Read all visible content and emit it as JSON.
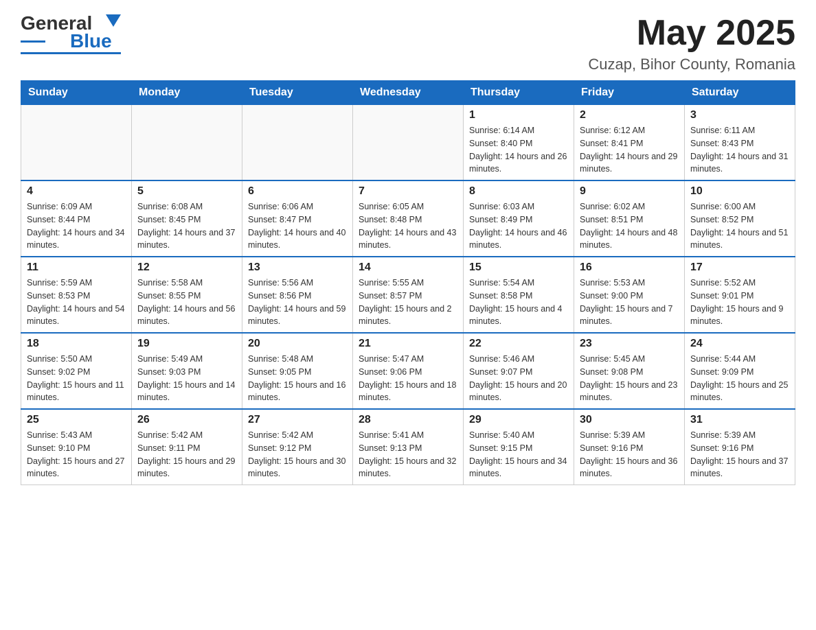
{
  "header": {
    "logo_general": "General",
    "logo_blue": "Blue",
    "month_title": "May 2025",
    "location": "Cuzap, Bihor County, Romania"
  },
  "days_of_week": [
    "Sunday",
    "Monday",
    "Tuesday",
    "Wednesday",
    "Thursday",
    "Friday",
    "Saturday"
  ],
  "weeks": [
    [
      {
        "day": "",
        "info": ""
      },
      {
        "day": "",
        "info": ""
      },
      {
        "day": "",
        "info": ""
      },
      {
        "day": "",
        "info": ""
      },
      {
        "day": "1",
        "info": "Sunrise: 6:14 AM\nSunset: 8:40 PM\nDaylight: 14 hours and 26 minutes."
      },
      {
        "day": "2",
        "info": "Sunrise: 6:12 AM\nSunset: 8:41 PM\nDaylight: 14 hours and 29 minutes."
      },
      {
        "day": "3",
        "info": "Sunrise: 6:11 AM\nSunset: 8:43 PM\nDaylight: 14 hours and 31 minutes."
      }
    ],
    [
      {
        "day": "4",
        "info": "Sunrise: 6:09 AM\nSunset: 8:44 PM\nDaylight: 14 hours and 34 minutes."
      },
      {
        "day": "5",
        "info": "Sunrise: 6:08 AM\nSunset: 8:45 PM\nDaylight: 14 hours and 37 minutes."
      },
      {
        "day": "6",
        "info": "Sunrise: 6:06 AM\nSunset: 8:47 PM\nDaylight: 14 hours and 40 minutes."
      },
      {
        "day": "7",
        "info": "Sunrise: 6:05 AM\nSunset: 8:48 PM\nDaylight: 14 hours and 43 minutes."
      },
      {
        "day": "8",
        "info": "Sunrise: 6:03 AM\nSunset: 8:49 PM\nDaylight: 14 hours and 46 minutes."
      },
      {
        "day": "9",
        "info": "Sunrise: 6:02 AM\nSunset: 8:51 PM\nDaylight: 14 hours and 48 minutes."
      },
      {
        "day": "10",
        "info": "Sunrise: 6:00 AM\nSunset: 8:52 PM\nDaylight: 14 hours and 51 minutes."
      }
    ],
    [
      {
        "day": "11",
        "info": "Sunrise: 5:59 AM\nSunset: 8:53 PM\nDaylight: 14 hours and 54 minutes."
      },
      {
        "day": "12",
        "info": "Sunrise: 5:58 AM\nSunset: 8:55 PM\nDaylight: 14 hours and 56 minutes."
      },
      {
        "day": "13",
        "info": "Sunrise: 5:56 AM\nSunset: 8:56 PM\nDaylight: 14 hours and 59 minutes."
      },
      {
        "day": "14",
        "info": "Sunrise: 5:55 AM\nSunset: 8:57 PM\nDaylight: 15 hours and 2 minutes."
      },
      {
        "day": "15",
        "info": "Sunrise: 5:54 AM\nSunset: 8:58 PM\nDaylight: 15 hours and 4 minutes."
      },
      {
        "day": "16",
        "info": "Sunrise: 5:53 AM\nSunset: 9:00 PM\nDaylight: 15 hours and 7 minutes."
      },
      {
        "day": "17",
        "info": "Sunrise: 5:52 AM\nSunset: 9:01 PM\nDaylight: 15 hours and 9 minutes."
      }
    ],
    [
      {
        "day": "18",
        "info": "Sunrise: 5:50 AM\nSunset: 9:02 PM\nDaylight: 15 hours and 11 minutes."
      },
      {
        "day": "19",
        "info": "Sunrise: 5:49 AM\nSunset: 9:03 PM\nDaylight: 15 hours and 14 minutes."
      },
      {
        "day": "20",
        "info": "Sunrise: 5:48 AM\nSunset: 9:05 PM\nDaylight: 15 hours and 16 minutes."
      },
      {
        "day": "21",
        "info": "Sunrise: 5:47 AM\nSunset: 9:06 PM\nDaylight: 15 hours and 18 minutes."
      },
      {
        "day": "22",
        "info": "Sunrise: 5:46 AM\nSunset: 9:07 PM\nDaylight: 15 hours and 20 minutes."
      },
      {
        "day": "23",
        "info": "Sunrise: 5:45 AM\nSunset: 9:08 PM\nDaylight: 15 hours and 23 minutes."
      },
      {
        "day": "24",
        "info": "Sunrise: 5:44 AM\nSunset: 9:09 PM\nDaylight: 15 hours and 25 minutes."
      }
    ],
    [
      {
        "day": "25",
        "info": "Sunrise: 5:43 AM\nSunset: 9:10 PM\nDaylight: 15 hours and 27 minutes."
      },
      {
        "day": "26",
        "info": "Sunrise: 5:42 AM\nSunset: 9:11 PM\nDaylight: 15 hours and 29 minutes."
      },
      {
        "day": "27",
        "info": "Sunrise: 5:42 AM\nSunset: 9:12 PM\nDaylight: 15 hours and 30 minutes."
      },
      {
        "day": "28",
        "info": "Sunrise: 5:41 AM\nSunset: 9:13 PM\nDaylight: 15 hours and 32 minutes."
      },
      {
        "day": "29",
        "info": "Sunrise: 5:40 AM\nSunset: 9:15 PM\nDaylight: 15 hours and 34 minutes."
      },
      {
        "day": "30",
        "info": "Sunrise: 5:39 AM\nSunset: 9:16 PM\nDaylight: 15 hours and 36 minutes."
      },
      {
        "day": "31",
        "info": "Sunrise: 5:39 AM\nSunset: 9:16 PM\nDaylight: 15 hours and 37 minutes."
      }
    ]
  ]
}
